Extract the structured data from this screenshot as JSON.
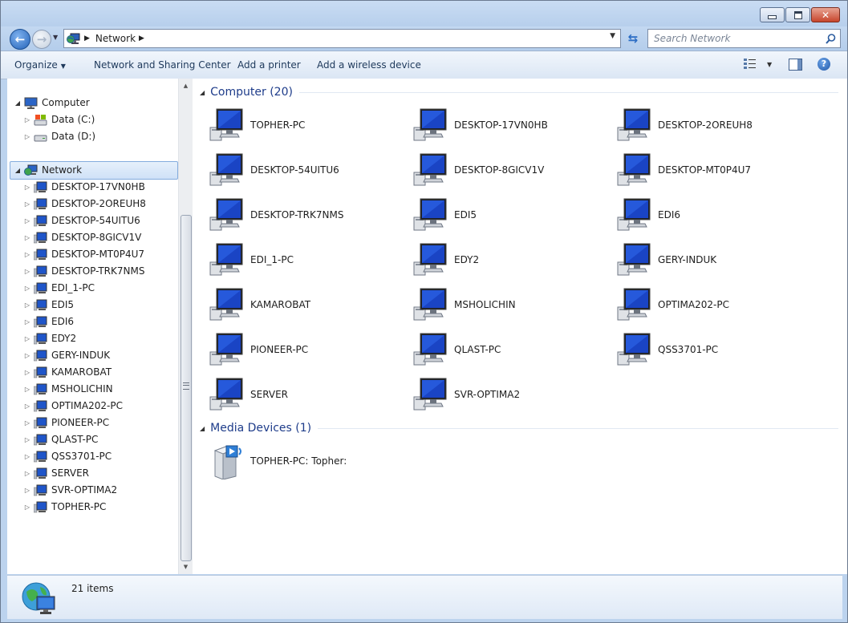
{
  "address": {
    "location": "Network"
  },
  "search": {
    "placeholder": "Search Network"
  },
  "toolbar": {
    "organize": "Organize",
    "network_sharing": "Network and Sharing Center",
    "add_printer": "Add a printer",
    "add_wireless": "Add a wireless device"
  },
  "nav": {
    "computer": "Computer",
    "drives": [
      "Data (C:)",
      "Data (D:)"
    ],
    "network": "Network",
    "network_items": [
      "DESKTOP-17VN0HB",
      "DESKTOP-2OREUH8",
      "DESKTOP-54UITU6",
      "DESKTOP-8GICV1V",
      "DESKTOP-MT0P4U7",
      "DESKTOP-TRK7NMS",
      "EDI_1-PC",
      "EDI5",
      "EDI6",
      "EDY2",
      "GERY-INDUK",
      "KAMAROBAT",
      "MSHOLICHIN",
      "OPTIMA202-PC",
      "PIONEER-PC",
      "QLAST-PC",
      "QSS3701-PC",
      "SERVER",
      "SVR-OPTIMA2",
      "TOPHER-PC"
    ]
  },
  "groups": {
    "computers_title": "Computer (20)",
    "computers": [
      "TOPHER-PC",
      "DESKTOP-17VN0HB",
      "DESKTOP-2OREUH8",
      "DESKTOP-54UITU6",
      "DESKTOP-8GICV1V",
      "DESKTOP-MT0P4U7",
      "DESKTOP-TRK7NMS",
      "EDI5",
      "EDI6",
      "EDI_1-PC",
      "EDY2",
      "GERY-INDUK",
      "KAMAROBAT",
      "MSHOLICHIN",
      "OPTIMA202-PC",
      "PIONEER-PC",
      "QLAST-PC",
      "QSS3701-PC",
      "SERVER",
      "SVR-OPTIMA2"
    ],
    "media_title": "Media Devices (1)",
    "media": [
      "TOPHER-PC: Topher:"
    ]
  },
  "status": {
    "items_count": "21 items"
  },
  "icons": {
    "back": "back-arrow-icon",
    "forward": "forward-arrow-icon",
    "refresh": "refresh-icon",
    "search": "search-icon",
    "computer": "computer-icon",
    "network": "network-icon",
    "drive": "drive-icon",
    "media": "media-server-icon",
    "help": "help-icon"
  }
}
